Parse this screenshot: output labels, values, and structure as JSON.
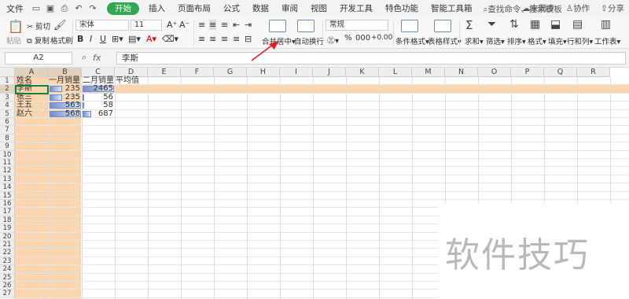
{
  "menubar": {
    "file": "文件",
    "tabs": [
      "开始",
      "插入",
      "页面布局",
      "公式",
      "数据",
      "审阅",
      "视图",
      "开发工具",
      "特色功能",
      "智能工具箱"
    ],
    "search": "查找命令、搜索模板",
    "sync": "未同步",
    "collab": "协作",
    "share": "分享"
  },
  "ribbon": {
    "paste": "粘贴",
    "cut": "剪切",
    "copy": "复制",
    "format_painter": "格式刷",
    "font_name": "宋体",
    "font_size": "11",
    "merge_center": "合并居中",
    "wrap_text": "自动换行",
    "number_format": "常规",
    "cond_format": "条件格式",
    "table_style": "表格样式",
    "sum": "求和",
    "filter": "筛选",
    "sort": "排序",
    "format": "格式",
    "fill": "填充",
    "rows_cols": "行和列",
    "worksheet": "工作表"
  },
  "formula": {
    "name_box": "A2",
    "fx": "fx",
    "content": "李斯"
  },
  "grid": {
    "columns": [
      "A",
      "B",
      "C",
      "D",
      "E",
      "F",
      "G",
      "H",
      "I",
      "J",
      "K",
      "L",
      "M",
      "N",
      "O",
      "P",
      "Q",
      "R"
    ],
    "rows": [
      "1",
      "2",
      "3",
      "4",
      "5",
      "6",
      "7",
      "8",
      "9",
      "10",
      "11",
      "12",
      "13",
      "14",
      "15",
      "16",
      "17",
      "18",
      "19",
      "20",
      "21",
      "22",
      "23",
      "24",
      "25",
      "26",
      "27"
    ],
    "headers": [
      "姓名",
      "一月销量",
      "二月销量",
      "平均值"
    ],
    "data": [
      {
        "name": "李斯",
        "jan": "235",
        "feb": "2465"
      },
      {
        "name": "张三",
        "jan": "235",
        "feb": "56"
      },
      {
        "name": "王五",
        "jan": "563",
        "feb": "58"
      },
      {
        "name": "赵六",
        "jan": "568",
        "feb": "687"
      }
    ],
    "databars_jan": [
      0.41,
      0.41,
      0.99,
      1.0
    ],
    "databars_feb": [
      1.0,
      0.02,
      0.02,
      0.28
    ]
  },
  "watermark": "软件技巧"
}
